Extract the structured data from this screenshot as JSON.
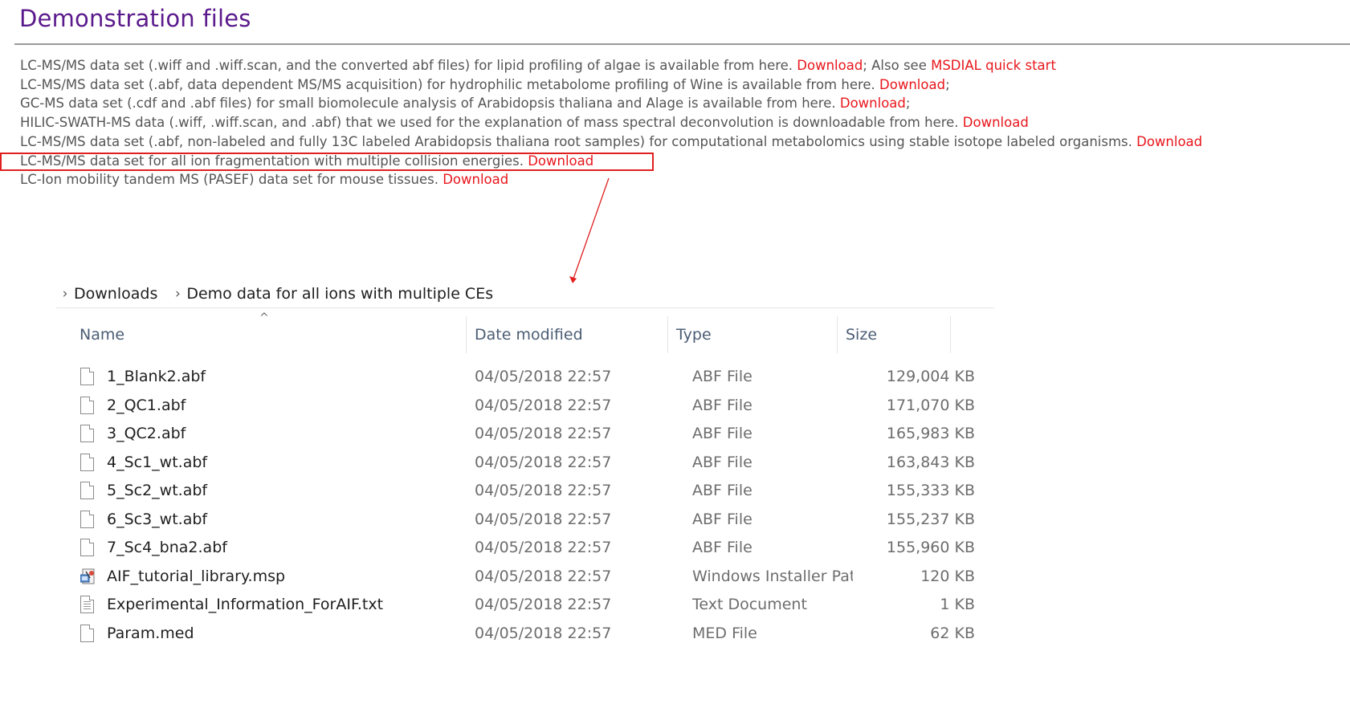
{
  "page": {
    "title": "Demonstration files"
  },
  "datasets": [
    {
      "text": "LC-MS/MS data set (.wiff and .wiff.scan, and the converted abf files) for lipid profiling of algae is available from here. ",
      "link": "Download",
      "after": "; Also see ",
      "link2": "MSDIAL quick start",
      "after2": ""
    },
    {
      "text": "LC-MS/MS data set (.abf, data dependent MS/MS acquisition) for hydrophilic metabolome profiling of Wine is available from here. ",
      "link": "Download",
      "after": ";",
      "link2": "",
      "after2": ""
    },
    {
      "text": "GC-MS data set (.cdf and .abf files) for small biomolecule analysis of Arabidopsis thaliana and Alage is available from here. ",
      "link": "Download",
      "after": ";",
      "link2": "",
      "after2": ""
    },
    {
      "text": "HILIC-SWATH-MS data (.wiff, .wiff.scan, and .abf) that we used for the explanation of mass spectral deconvolution is downloadable from here. ",
      "link": "Download",
      "after": "",
      "link2": "",
      "after2": ""
    },
    {
      "text": "LC-MS/MS data set (.abf, non-labeled and fully 13C labeled Arabidopsis thaliana root samples) for computational metabolomics using stable isotope labeled organisms. ",
      "link": "Download",
      "after": "",
      "link2": "",
      "after2": ""
    },
    {
      "text": "LC-MS/MS data set for all ion fragmentation with multiple collision energies. ",
      "link": "Download",
      "after": "",
      "link2": "",
      "after2": ""
    },
    {
      "text": "LC-Ion mobility tandem MS (PASEF) data set for mouse tissues. ",
      "link": "Download",
      "after": "",
      "link2": "",
      "after2": ""
    }
  ],
  "colors": {
    "title": "#5b1a8c",
    "link": "#e8161c",
    "highlight": "#e02020"
  },
  "explorer": {
    "breadcrumb": [
      "Downloads",
      "Demo data for all ions with multiple CEs"
    ],
    "columns": {
      "name": "Name",
      "date": "Date modified",
      "type": "Type",
      "size": "Size"
    },
    "sort_indicator": "^",
    "files": [
      {
        "icon": "file-icon",
        "name": "1_Blank2.abf",
        "date": "04/05/2018 22:57",
        "type": "ABF File",
        "size": "129,004 KB"
      },
      {
        "icon": "file-icon",
        "name": "2_QC1.abf",
        "date": "04/05/2018 22:57",
        "type": "ABF File",
        "size": "171,070 KB"
      },
      {
        "icon": "file-icon",
        "name": "3_QC2.abf",
        "date": "04/05/2018 22:57",
        "type": "ABF File",
        "size": "165,983 KB"
      },
      {
        "icon": "file-icon",
        "name": "4_Sc1_wt.abf",
        "date": "04/05/2018 22:57",
        "type": "ABF File",
        "size": "163,843 KB"
      },
      {
        "icon": "file-icon",
        "name": "5_Sc2_wt.abf",
        "date": "04/05/2018 22:57",
        "type": "ABF File",
        "size": "155,333 KB"
      },
      {
        "icon": "file-icon",
        "name": "6_Sc3_wt.abf",
        "date": "04/05/2018 22:57",
        "type": "ABF File",
        "size": "155,237 KB"
      },
      {
        "icon": "file-icon",
        "name": "7_Sc4_bna2.abf",
        "date": "04/05/2018 22:57",
        "type": "ABF File",
        "size": "155,960 KB"
      },
      {
        "icon": "installer-patch-icon",
        "name": "AIF_tutorial_library.msp",
        "date": "04/05/2018 22:57",
        "type": "Windows Installer Pat...",
        "size": "120 KB"
      },
      {
        "icon": "text-document-icon",
        "name": "Experimental_Information_ForAIF.txt",
        "date": "04/05/2018 22:57",
        "type": "Text Document",
        "size": "1 KB"
      },
      {
        "icon": "file-icon",
        "name": "Param.med",
        "date": "04/05/2018 22:57",
        "type": "MED File",
        "size": "62 KB"
      }
    ]
  }
}
